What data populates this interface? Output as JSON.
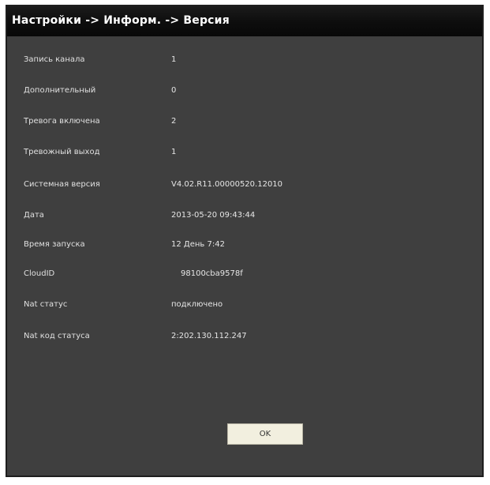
{
  "window": {
    "title": "Настройки -> Информ. -> Версия"
  },
  "info": {
    "rows": [
      {
        "label": "Запись канала",
        "value": "1"
      },
      {
        "label": "Дополнительный",
        "value": "0"
      },
      {
        "label": "Тревога включена",
        "value": "2"
      },
      {
        "label": "Тревожный выход",
        "value": "1"
      },
      {
        "label": "Системная версия",
        "value": "V4.02.R11.00000520.12010"
      },
      {
        "label": "Дата",
        "value": "2013-05-20 09:43:44"
      },
      {
        "label": "Время запуска",
        "value": "12 День 7:42"
      },
      {
        "label": "CloudID",
        "value": "98100cba9578f"
      },
      {
        "label": "Nat статус",
        "value": "подключено"
      },
      {
        "label": "Nat код статуса",
        "value": "2:202.130.112.247"
      }
    ]
  },
  "buttons": {
    "ok_label": "OK"
  }
}
